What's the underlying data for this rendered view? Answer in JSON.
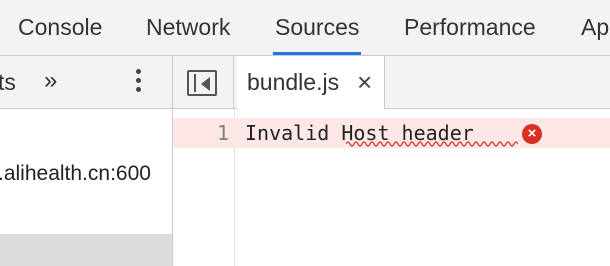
{
  "main_tabs": [
    {
      "label": "Console"
    },
    {
      "label": "Network"
    },
    {
      "label": "Sources",
      "active": true
    },
    {
      "label": "Performance"
    },
    {
      "label": "Ap"
    }
  ],
  "navigator": {
    "partial_tab_label": "ts",
    "more_tabs_glyph": "»",
    "menu_icon": "kebab-menu-icon",
    "item_label": ".alihealth.cn:600"
  },
  "editor": {
    "toggle_icon": "toggle-navigator-icon",
    "file_tab": {
      "label": "bundle.js",
      "close_glyph": "×"
    },
    "lines": [
      {
        "number": "1",
        "text": "Invalid Host header",
        "has_error": true
      }
    ]
  },
  "colors": {
    "accent": "#1a73e8",
    "error": "#d93025",
    "error_line_bg": "#fde7e7",
    "toolbar_bg": "#f3f3f3"
  }
}
